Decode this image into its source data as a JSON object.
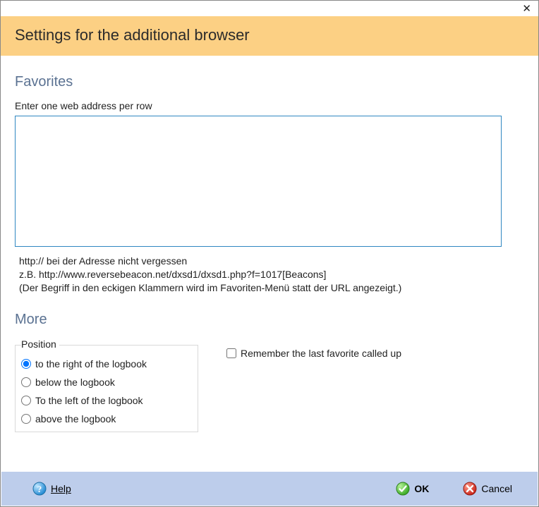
{
  "banner": {
    "title": "Settings for the additional browser"
  },
  "favorites": {
    "heading": "Favorites",
    "label": "Enter one web address per row",
    "value": "",
    "hint1": "http:// bei der Adresse nicht vergessen",
    "hint2": "z.B. http://www.reversebeacon.net/dxsd1/dxsd1.php?f=1017[Beacons]",
    "hint3": "(Der Begriff in den eckigen Klammern wird im Favoriten-Menü statt der URL angezeigt.)"
  },
  "more": {
    "heading": "More",
    "position": {
      "legend": "Position",
      "options": [
        {
          "label": "to the right of the logbook",
          "selected": true
        },
        {
          "label": "below the logbook",
          "selected": false
        },
        {
          "label": "To the left of the logbook",
          "selected": false
        },
        {
          "label": "above the logbook",
          "selected": false
        }
      ]
    },
    "remember": {
      "label": "Remember the last favorite called up",
      "checked": false
    }
  },
  "buttons": {
    "help": "Help",
    "ok": "OK",
    "cancel": "Cancel"
  }
}
